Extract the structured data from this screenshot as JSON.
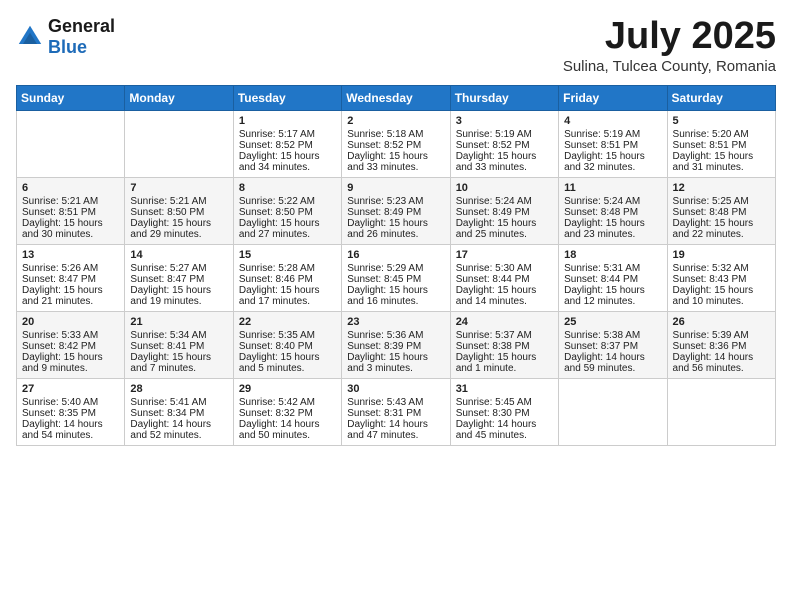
{
  "header": {
    "logo_general": "General",
    "logo_blue": "Blue",
    "month": "July 2025",
    "location": "Sulina, Tulcea County, Romania"
  },
  "days_of_week": [
    "Sunday",
    "Monday",
    "Tuesday",
    "Wednesday",
    "Thursday",
    "Friday",
    "Saturday"
  ],
  "weeks": [
    [
      {
        "day": "",
        "info": ""
      },
      {
        "day": "",
        "info": ""
      },
      {
        "day": "1",
        "info": "Sunrise: 5:17 AM\nSunset: 8:52 PM\nDaylight: 15 hours and 34 minutes."
      },
      {
        "day": "2",
        "info": "Sunrise: 5:18 AM\nSunset: 8:52 PM\nDaylight: 15 hours and 33 minutes."
      },
      {
        "day": "3",
        "info": "Sunrise: 5:19 AM\nSunset: 8:52 PM\nDaylight: 15 hours and 33 minutes."
      },
      {
        "day": "4",
        "info": "Sunrise: 5:19 AM\nSunset: 8:51 PM\nDaylight: 15 hours and 32 minutes."
      },
      {
        "day": "5",
        "info": "Sunrise: 5:20 AM\nSunset: 8:51 PM\nDaylight: 15 hours and 31 minutes."
      }
    ],
    [
      {
        "day": "6",
        "info": "Sunrise: 5:21 AM\nSunset: 8:51 PM\nDaylight: 15 hours and 30 minutes."
      },
      {
        "day": "7",
        "info": "Sunrise: 5:21 AM\nSunset: 8:50 PM\nDaylight: 15 hours and 29 minutes."
      },
      {
        "day": "8",
        "info": "Sunrise: 5:22 AM\nSunset: 8:50 PM\nDaylight: 15 hours and 27 minutes."
      },
      {
        "day": "9",
        "info": "Sunrise: 5:23 AM\nSunset: 8:49 PM\nDaylight: 15 hours and 26 minutes."
      },
      {
        "day": "10",
        "info": "Sunrise: 5:24 AM\nSunset: 8:49 PM\nDaylight: 15 hours and 25 minutes."
      },
      {
        "day": "11",
        "info": "Sunrise: 5:24 AM\nSunset: 8:48 PM\nDaylight: 15 hours and 23 minutes."
      },
      {
        "day": "12",
        "info": "Sunrise: 5:25 AM\nSunset: 8:48 PM\nDaylight: 15 hours and 22 minutes."
      }
    ],
    [
      {
        "day": "13",
        "info": "Sunrise: 5:26 AM\nSunset: 8:47 PM\nDaylight: 15 hours and 21 minutes."
      },
      {
        "day": "14",
        "info": "Sunrise: 5:27 AM\nSunset: 8:47 PM\nDaylight: 15 hours and 19 minutes."
      },
      {
        "day": "15",
        "info": "Sunrise: 5:28 AM\nSunset: 8:46 PM\nDaylight: 15 hours and 17 minutes."
      },
      {
        "day": "16",
        "info": "Sunrise: 5:29 AM\nSunset: 8:45 PM\nDaylight: 15 hours and 16 minutes."
      },
      {
        "day": "17",
        "info": "Sunrise: 5:30 AM\nSunset: 8:44 PM\nDaylight: 15 hours and 14 minutes."
      },
      {
        "day": "18",
        "info": "Sunrise: 5:31 AM\nSunset: 8:44 PM\nDaylight: 15 hours and 12 minutes."
      },
      {
        "day": "19",
        "info": "Sunrise: 5:32 AM\nSunset: 8:43 PM\nDaylight: 15 hours and 10 minutes."
      }
    ],
    [
      {
        "day": "20",
        "info": "Sunrise: 5:33 AM\nSunset: 8:42 PM\nDaylight: 15 hours and 9 minutes."
      },
      {
        "day": "21",
        "info": "Sunrise: 5:34 AM\nSunset: 8:41 PM\nDaylight: 15 hours and 7 minutes."
      },
      {
        "day": "22",
        "info": "Sunrise: 5:35 AM\nSunset: 8:40 PM\nDaylight: 15 hours and 5 minutes."
      },
      {
        "day": "23",
        "info": "Sunrise: 5:36 AM\nSunset: 8:39 PM\nDaylight: 15 hours and 3 minutes."
      },
      {
        "day": "24",
        "info": "Sunrise: 5:37 AM\nSunset: 8:38 PM\nDaylight: 15 hours and 1 minute."
      },
      {
        "day": "25",
        "info": "Sunrise: 5:38 AM\nSunset: 8:37 PM\nDaylight: 14 hours and 59 minutes."
      },
      {
        "day": "26",
        "info": "Sunrise: 5:39 AM\nSunset: 8:36 PM\nDaylight: 14 hours and 56 minutes."
      }
    ],
    [
      {
        "day": "27",
        "info": "Sunrise: 5:40 AM\nSunset: 8:35 PM\nDaylight: 14 hours and 54 minutes."
      },
      {
        "day": "28",
        "info": "Sunrise: 5:41 AM\nSunset: 8:34 PM\nDaylight: 14 hours and 52 minutes."
      },
      {
        "day": "29",
        "info": "Sunrise: 5:42 AM\nSunset: 8:32 PM\nDaylight: 14 hours and 50 minutes."
      },
      {
        "day": "30",
        "info": "Sunrise: 5:43 AM\nSunset: 8:31 PM\nDaylight: 14 hours and 47 minutes."
      },
      {
        "day": "31",
        "info": "Sunrise: 5:45 AM\nSunset: 8:30 PM\nDaylight: 14 hours and 45 minutes."
      },
      {
        "day": "",
        "info": ""
      },
      {
        "day": "",
        "info": ""
      }
    ]
  ]
}
